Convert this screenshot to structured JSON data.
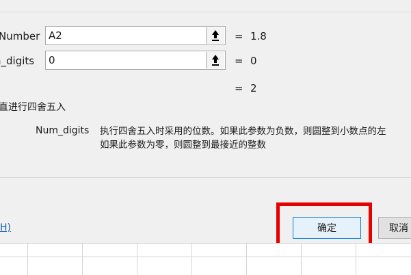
{
  "dialog": {
    "args": [
      {
        "label": "Number",
        "value": "A2",
        "result": "1.8"
      },
      {
        "label": "n_digits",
        "value": "0",
        "result": "0"
      }
    ],
    "equals": "=",
    "total_result": "2",
    "function_desc": "直进行四舍五入",
    "param_name": "Num_digits",
    "param_desc_line1": "执行四舍五入时采用的位数。如果此参数为负数，则圆整到小数点的左",
    "param_desc_line2": "如果此参数为零，则圆整到最接近的整数",
    "help_link": "H)",
    "ok_label": "确定",
    "cancel_label": "取消"
  },
  "icons": {
    "collapse": "collapse-dialog-icon"
  },
  "colors": {
    "highlight": "#e60000",
    "accent": "#0078d7",
    "link": "#1a5fb4"
  }
}
